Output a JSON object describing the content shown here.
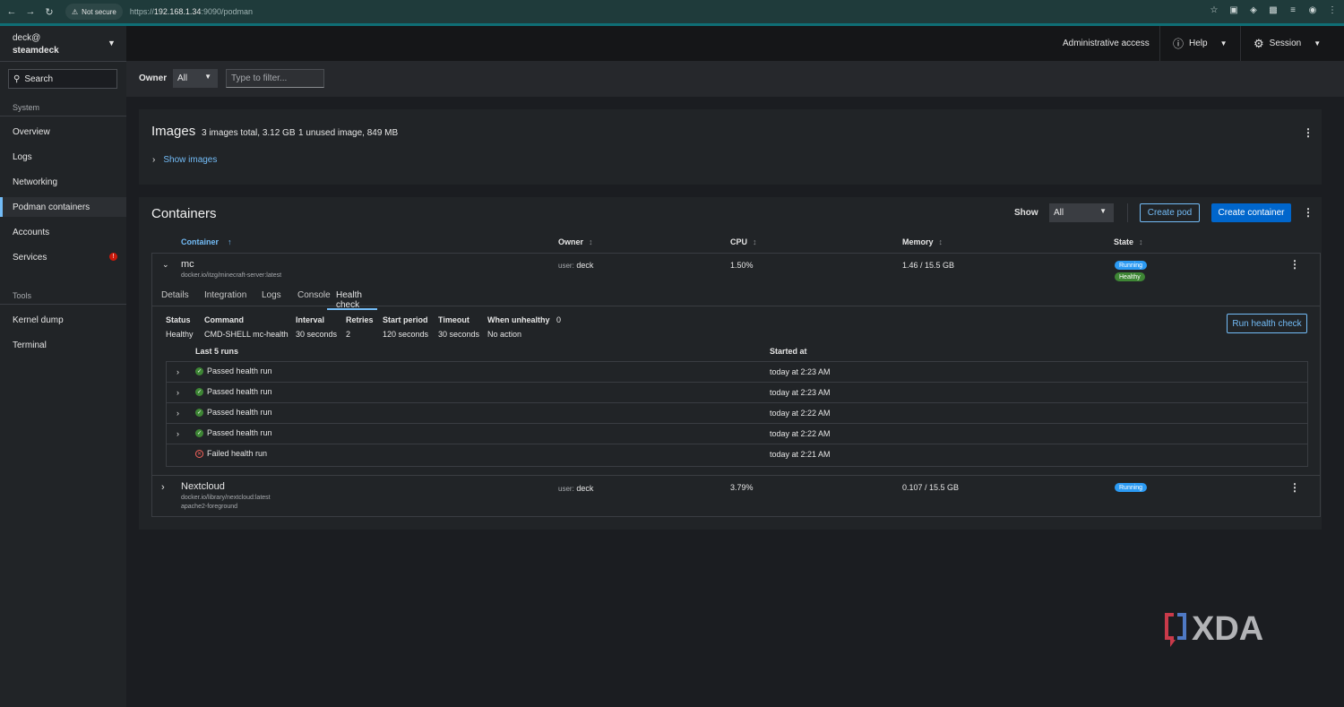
{
  "browser": {
    "security_label": "Not secure",
    "url_scheme": "https://",
    "url_host": "192.168.1.34",
    "url_rest": ":9090/podman"
  },
  "sidebar": {
    "user": "deck@",
    "host": "steamdeck",
    "search_placeholder": "Search",
    "section_system": "System",
    "section_tools": "Tools",
    "items": [
      {
        "label": "Overview"
      },
      {
        "label": "Logs"
      },
      {
        "label": "Networking"
      },
      {
        "label": "Podman containers"
      },
      {
        "label": "Accounts"
      },
      {
        "label": "Services",
        "badge": "!"
      },
      {
        "label": "Kernel dump"
      },
      {
        "label": "Terminal"
      }
    ]
  },
  "topbar": {
    "admin_access": "Administrative access",
    "help": "Help",
    "session": "Session"
  },
  "filter": {
    "owner_label": "Owner",
    "owner_value": "All",
    "filter_placeholder": "Type to filter..."
  },
  "images": {
    "title": "Images",
    "total": "3 images total, 3.12 GB",
    "unused": "1 unused image, 849 MB",
    "show_link": "Show images"
  },
  "containers": {
    "title": "Containers",
    "show_label": "Show",
    "show_value": "All",
    "create_pod": "Create pod",
    "create_container": "Create container",
    "columns": [
      "Container",
      "Owner",
      "CPU",
      "Memory",
      "State"
    ],
    "rows": [
      {
        "name": "mc",
        "image": "docker.io/itzg/minecraft-server:latest",
        "owner_prefix": "user:",
        "owner": "deck",
        "cpu": "1.50%",
        "memory": "1.46 / 15.5 GB",
        "state": "Running",
        "health": "Healthy"
      },
      {
        "name": "Nextcloud",
        "image": "docker.io/library/nextcloud:latest",
        "command": "apache2-foreground",
        "owner_prefix": "user:",
        "owner": "deck",
        "cpu": "3.79%",
        "memory": "0.107 / 15.5 GB",
        "state": "Running"
      }
    ]
  },
  "tabs": [
    "Details",
    "Integration",
    "Logs",
    "Console",
    "Health check"
  ],
  "health": {
    "labels": {
      "status": "Status",
      "command": "Command",
      "interval": "Interval",
      "retries": "Retries",
      "start_period": "Start period",
      "timeout": "Timeout",
      "when_unhealthy": "When unhealthy"
    },
    "failing_streak": "0",
    "values": {
      "status": "Healthy",
      "command": "CMD-SHELL mc-health",
      "interval": "30 seconds",
      "retries": "2",
      "start_period": "120 seconds",
      "timeout": "30 seconds",
      "when_unhealthy": "No action"
    },
    "run_button": "Run health check",
    "runs_header": "Last 5 runs",
    "started_header": "Started at",
    "runs": [
      {
        "label": "Passed health run",
        "time": "today at 2:23 AM",
        "status": "pass"
      },
      {
        "label": "Passed health run",
        "time": "today at 2:23 AM",
        "status": "pass"
      },
      {
        "label": "Passed health run",
        "time": "today at 2:22 AM",
        "status": "pass"
      },
      {
        "label": "Passed health run",
        "time": "today at 2:22 AM",
        "status": "pass"
      },
      {
        "label": "Failed health run",
        "time": "today at 2:21 AM",
        "status": "fail"
      }
    ]
  },
  "watermark": "XDA",
  "colors": {
    "accent": "#73bcf7",
    "primary": "#0066cc",
    "running": "#2b9af3",
    "healthy": "#3e8635",
    "fail": "#f0625a"
  }
}
